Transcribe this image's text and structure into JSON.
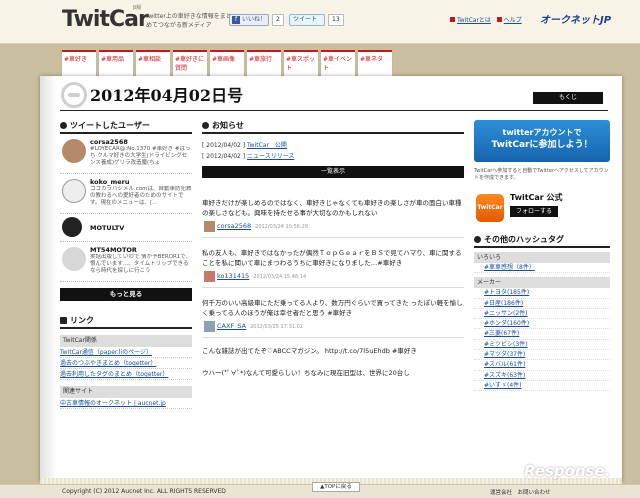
{
  "header": {
    "logo_main": "TwitCar",
    "logo_beta": "β版",
    "tagline": "twitter上の車好きな情報をまとめてつながる新メディア",
    "fb_like": "いいね！",
    "fb_count": "2",
    "tweet_label": "ツイート",
    "tweet_count": "13",
    "links": [
      "TwitCarとは",
      "ヘルプ"
    ],
    "aucnet": "オークネットJP"
  },
  "tabs": [
    "#車好き",
    "#車用品",
    "#車相談",
    "#車好きに質問",
    "#車画像",
    "#車旅行",
    "#車スポット",
    "#車イベント",
    "#車ネタ"
  ],
  "page": {
    "date_title": "2012年04月02日号",
    "mokuji": "もくじ"
  },
  "left": {
    "tweeted_users_title": "ツイートしたユーザー",
    "users": [
      {
        "name": "corsa2568",
        "bio": "#LOYECAR@:No.1370 #車好き #ばっち クルマ好きの大学生(ドライビングセンス養成)ゲリラ改造魔(ちょ"
      },
      {
        "name": "koko_meru",
        "bio": "ココカラハジメル.comは、自動車防犯教の教わるへの愛好者のためのサイトです。現在のメニューは、[…"
      },
      {
        "name": "MOTULTV",
        "bio": ""
      },
      {
        "name": "MT54MOTOR",
        "bio": "実話出版していので 情が予BEROR1で、恨んでいます…、タイムトリップできるなら時代を探しに行こう"
      }
    ],
    "more_button": "もっと見る",
    "links_title": "リンク",
    "link_cat1": "TwitCar関係",
    "link_items1": [
      "TwitCar通信（paper.liのページ）",
      "過去のつぶやきまとめ（togetter）",
      "過去利用したタグのまとめ（togetter）"
    ],
    "link_cat2": "関連サイト",
    "link_items2": [
      "中古車情報のオークネット | aucnet.jp"
    ]
  },
  "mid": {
    "news_title": "お知らせ",
    "news": [
      {
        "date": "[ 2012/04/02 ]",
        "text": "TwitCar　公開"
      },
      {
        "date": "[ 2012/04/02 ]",
        "text": "ニュースリリース"
      }
    ],
    "ichiran": "一覧表示",
    "tweets": [
      {
        "text": "車好きだけが楽しめるのではなく、車好きじゃなくても車好きの楽しさが車の面白い車種の楽しさなども。興味を持たせる事が大切なのかもしれない",
        "user": "corsa2568",
        "time": "2012/03/24 10:56:28"
      },
      {
        "text": "私の友人も、車好きではなかったが偶然ＴｏｐＧｅａｒをＢＳで見てハマり、車に関することを私に聞いて車にまつわるうちに車好きになりました…#車好き",
        "user": "ko131415",
        "time": "2012/03/24 15:46:14"
      },
      {
        "text": "何千万のいい高級車にただ乗ってる人より、数万円ぐらいで買ってきた ったぽい軽を愉しく乗ってる人のほうが俺は幸せ者だと思う #車好き",
        "user": "CAXF_SA",
        "time": "2012/03/25 17:31:02"
      },
      {
        "text": "こんな雑誌が出てたぞ♡ABCCマガジン。 http://t.co/7l5uEhdb #車好き",
        "user": "",
        "time": ""
      },
      {
        "text": "ウハー(*ﾟ∀ﾟ*)なんて可愛らしい！ちなみに現在旧型は、世界に20台し",
        "user": "",
        "time": ""
      }
    ]
  },
  "right": {
    "tw_banner_line1": "twitterアカウントで",
    "tw_banner_line2": "TwitCarに参加しよう！",
    "tw_note": "TwitCarへ参加すると自動でTwitterへアクセスしてアカウントを作成できます。",
    "official_name": "TwitCar 公式",
    "app_label": "TwitCar",
    "follow": "フォローする",
    "hash_title": "その他のハッシュタグ",
    "hash_cat1": "いろいろ",
    "hash_items1": [
      "#車車感想（8件）"
    ],
    "hash_cat2": "メーカー",
    "hash_items2": [
      "#トヨタ(185件)",
      "#日産(186件)",
      "#ニッサン(2件)",
      "#ホンダ(160件)",
      "#三菱(67件)",
      "#ミツビシ(3件)",
      "#マツダ(37件)",
      "#スバル(61件)",
      "#スズキ(63件)",
      "#いすゞ(4件)"
    ]
  },
  "footer": {
    "top_button": "▲TOPに戻る",
    "copyright": "Copyright (C) 2012 Aucnet Inc. ALL RIGHTS RESERVED",
    "links": "運営会社　お問い合わせ",
    "watermark": "Response."
  }
}
